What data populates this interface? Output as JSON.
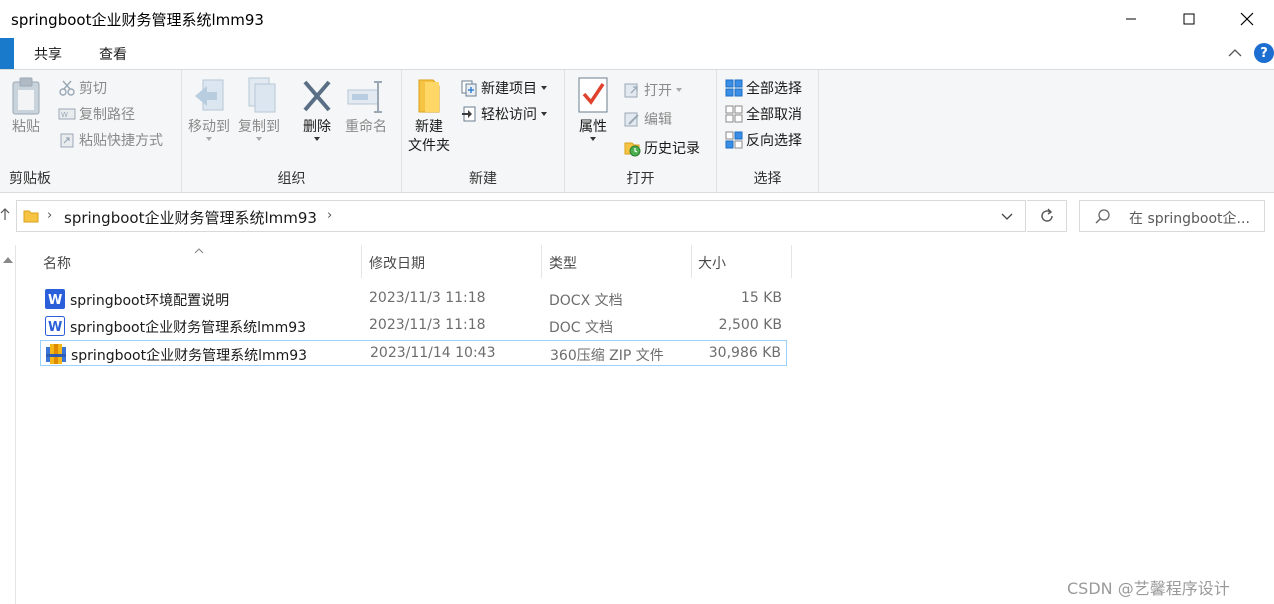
{
  "window": {
    "title": "springboot企业财务管理系统lmm93"
  },
  "ribbon_tabs": [
    "共享",
    "查看"
  ],
  "help_label": "?",
  "ribbon": {
    "clipboard": {
      "group_label": "剪贴板",
      "paste": "粘贴",
      "cut": "剪切",
      "copy_path": "复制路径",
      "paste_shortcut": "粘贴快捷方式"
    },
    "organize": {
      "group_label": "组织",
      "move_to": "移动到",
      "copy_to": "复制到",
      "delete": "删除",
      "rename": "重命名"
    },
    "new": {
      "group_label": "新建",
      "new_folder_line1": "新建",
      "new_folder_line2": "文件夹",
      "new_item": "新建项目",
      "easy_access": "轻松访问"
    },
    "open": {
      "group_label": "打开",
      "properties": "属性",
      "open": "打开",
      "edit": "编辑",
      "history": "历史记录"
    },
    "select": {
      "group_label": "选择",
      "select_all": "全部选择",
      "select_none": "全部取消",
      "invert": "反向选择"
    }
  },
  "address": {
    "path": "springboot企业财务管理系统lmm93",
    "search_placeholder": "在 springboot企..."
  },
  "columns": {
    "name": "名称",
    "date": "修改日期",
    "type": "类型",
    "size": "大小"
  },
  "files": [
    {
      "name": "springboot环境配置说明",
      "date": "2023/11/3 11:18",
      "type": "DOCX 文档",
      "size": "15 KB",
      "icon": "word-docx-icon"
    },
    {
      "name": "springboot企业财务管理系统lmm93",
      "date": "2023/11/3 11:18",
      "type": "DOC 文档",
      "size": "2,500 KB",
      "icon": "word-doc-icon"
    },
    {
      "name": "springboot企业财务管理系统lmm93",
      "date": "2023/11/14 10:43",
      "type": "360压缩 ZIP 文件",
      "size": "30,986 KB",
      "icon": "zip-archive-icon"
    }
  ],
  "watermark": "CSDN @艺馨程序设计"
}
